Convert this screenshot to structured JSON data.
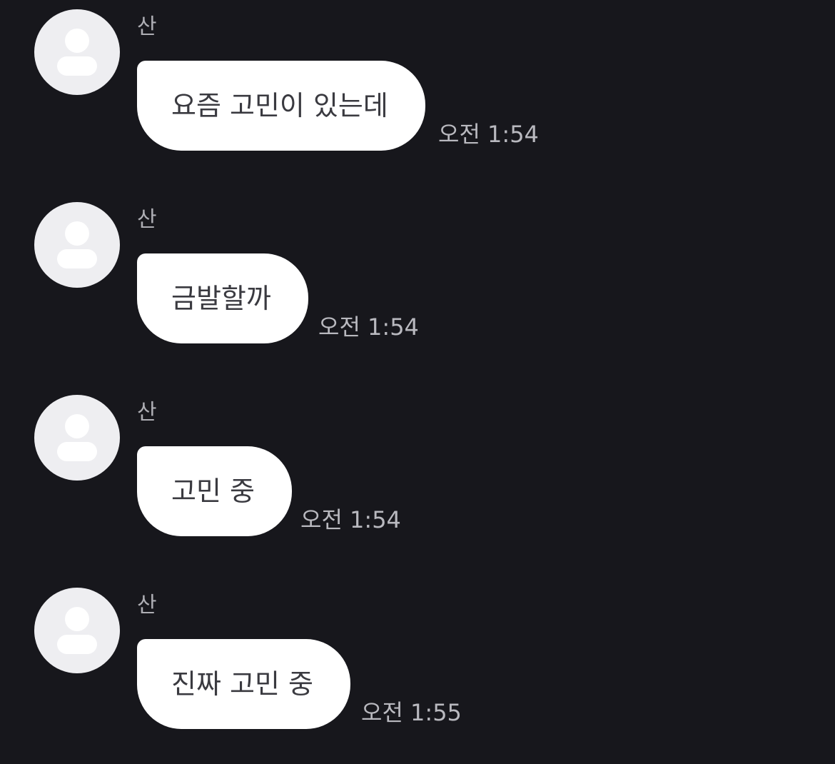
{
  "messages": [
    {
      "sender": "산",
      "text": "요즘 고민이 있는데",
      "time": "오전 1:54"
    },
    {
      "sender": "산",
      "text": "금발할까",
      "time": "오전 1:54"
    },
    {
      "sender": "산",
      "text": "고민 중",
      "time": "오전 1:54"
    },
    {
      "sender": "산",
      "text": "진짜 고민 중",
      "time": "오전 1:55"
    }
  ],
  "icons": {
    "avatar": "default-user-avatar-icon"
  },
  "colors": {
    "background": "#17171c",
    "bubble": "#ffffff",
    "bubble_text": "#3a3a40",
    "sender_text": "#aeaeb4",
    "time_text": "#b9b9bf",
    "avatar": "#eeeef1"
  }
}
